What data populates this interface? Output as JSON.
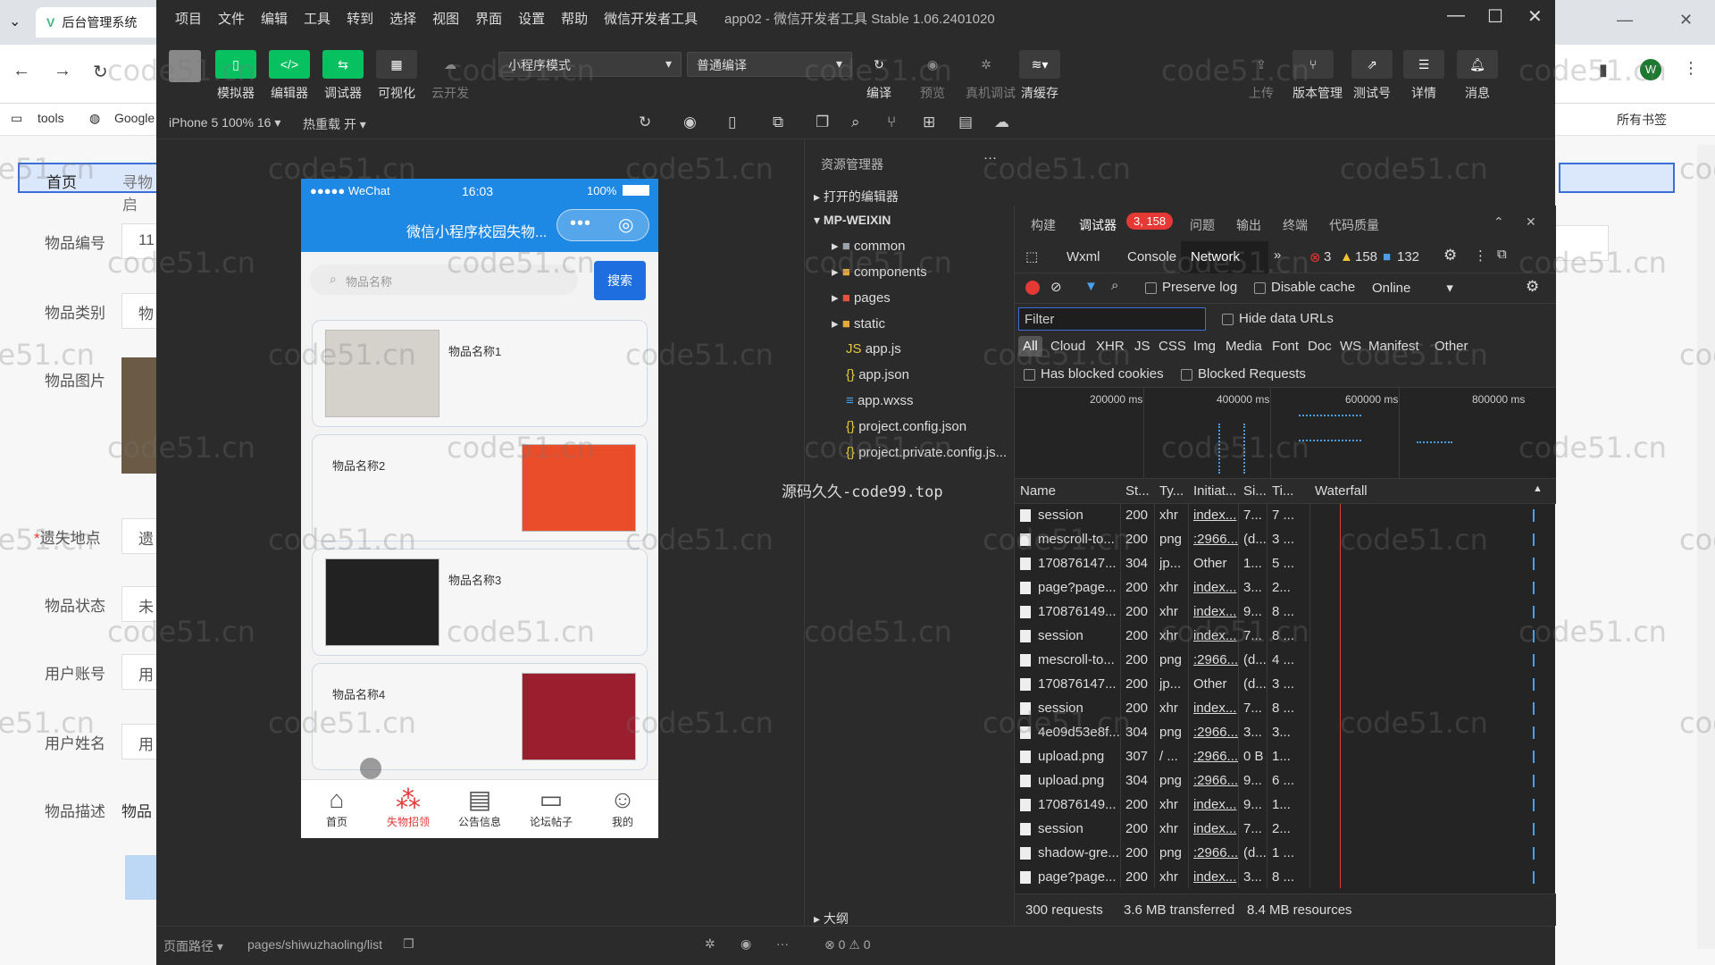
{
  "browser": {
    "tab_title": "后台管理系统",
    "bookmarks": [
      "tools",
      "Google"
    ],
    "all_bookmarks": "所有书签",
    "nav_items": [
      "首页",
      "寻物启"
    ],
    "form_labels": [
      "物品编号",
      "物品类别",
      "物品图片",
      "遗失地点",
      "物品状态",
      "用户账号",
      "用户姓名",
      "物品描述"
    ],
    "form_values": [
      "11",
      "物",
      "",
      "遗",
      "未",
      "用",
      "用",
      "物品"
    ]
  },
  "watermark": "code51.cn",
  "center_watermark": "源码久久-code99.top",
  "window": {
    "menu": [
      "项目",
      "文件",
      "编辑",
      "工具",
      "转到",
      "选择",
      "视图",
      "界面",
      "设置",
      "帮助",
      "微信开发者工具"
    ],
    "title": "app02 - 微信开发者工具 Stable 1.06.2401020"
  },
  "toolbar": {
    "simulator": "模拟器",
    "editor": "编辑器",
    "debugger": "调试器",
    "visual": "可视化",
    "cloud": "云开发",
    "mode_select": "小程序模式",
    "compile_select": "普通编译",
    "compile": "编译",
    "preview": "预览",
    "real_debug": "真机调试",
    "clear_cache": "清缓存",
    "upload": "上传",
    "version": "版本管理",
    "test": "测试号",
    "detail": "详情",
    "message": "消息"
  },
  "subbar": {
    "device": "iPhone 5 100% 16 ▾",
    "hot_reload": "热重载 开 ▾"
  },
  "phone": {
    "signal": "●●●●● WeChat",
    "time": "16:03",
    "battery": "100%",
    "title": "微信小程序校园失物...",
    "search_placeholder": "物品名称",
    "search_button": "搜索",
    "items": [
      "物品名称1",
      "物品名称2",
      "物品名称3",
      "物品名称4"
    ],
    "tabs": [
      "首页",
      "失物招领",
      "公告信息",
      "论坛帖子",
      "我的"
    ]
  },
  "explorer": {
    "header": "资源管理器",
    "open_editors": "打开的编辑器",
    "root": "MP-WEIXIN",
    "folders": [
      "common",
      "components",
      "pages",
      "static"
    ],
    "files": [
      "app.js",
      "app.json",
      "app.wxss",
      "project.config.json",
      "project.private.config.js..."
    ],
    "outline": "大纲"
  },
  "devtools": {
    "tabs": [
      "构建",
      "调试器",
      "问题",
      "输出",
      "终端",
      "代码质量"
    ],
    "badge": "3, 158",
    "panels": [
      "Wxml",
      "Console",
      "Network"
    ],
    "errors": "3",
    "warnings": "158",
    "infos": "132",
    "preserve_log": "Preserve log",
    "disable_cache": "Disable cache",
    "throttle": "Online",
    "filter_placeholder": "Filter",
    "hide_data_urls": "Hide data URLs",
    "types": [
      "All",
      "Cloud",
      "XHR",
      "JS",
      "CSS",
      "Img",
      "Media",
      "Font",
      "Doc",
      "WS",
      "Manifest",
      "Other"
    ],
    "has_blocked": "Has blocked cookies",
    "blocked_requests": "Blocked Requests",
    "timeline": [
      "200000 ms",
      "400000 ms",
      "600000 ms",
      "800000 ms"
    ],
    "columns": [
      "Name",
      "St...",
      "Ty...",
      "Initiat...",
      "Si...",
      "Ti...",
      "Waterfall"
    ],
    "rows": [
      [
        "session",
        "200",
        "xhr",
        "index...",
        "7...",
        "7 ..."
      ],
      [
        "mescroll-to...",
        "200",
        "png",
        ":2966...",
        "(d...",
        "3 ..."
      ],
      [
        "170876147...",
        "304",
        "jp...",
        "Other",
        "1...",
        "5 ..."
      ],
      [
        "page?page...",
        "200",
        "xhr",
        "index...",
        "3...",
        "2..."
      ],
      [
        "170876149...",
        "200",
        "xhr",
        "index...",
        "9...",
        "8 ..."
      ],
      [
        "session",
        "200",
        "xhr",
        "index...",
        "7...",
        "8 ..."
      ],
      [
        "mescroll-to...",
        "200",
        "png",
        ":2966...",
        "(d...",
        "4 ..."
      ],
      [
        "170876147...",
        "200",
        "jp...",
        "Other",
        "(d...",
        "3 ..."
      ],
      [
        "session",
        "200",
        "xhr",
        "index...",
        "7...",
        "8 ..."
      ],
      [
        "4e09d53e8f...",
        "304",
        "png",
        ":2966...",
        "3...",
        "3..."
      ],
      [
        "upload.png",
        "307",
        "/ ...",
        ":2966...",
        "0 B",
        "1..."
      ],
      [
        "upload.png",
        "304",
        "png",
        ":2966...",
        "9...",
        "6 ..."
      ],
      [
        "170876149...",
        "200",
        "xhr",
        "index...",
        "9...",
        "1..."
      ],
      [
        "session",
        "200",
        "xhr",
        "index...",
        "7...",
        "2..."
      ],
      [
        "shadow-gre...",
        "200",
        "png",
        ":2966...",
        "(d...",
        "1 ..."
      ],
      [
        "page?page...",
        "200",
        "xhr",
        "index...",
        "3...",
        "8 ..."
      ]
    ],
    "summary": [
      "300 requests",
      "3.6 MB transferred",
      "8.4 MB resources"
    ]
  },
  "status": {
    "route_label": "页面路径 ▾",
    "route": "pages/shiwuzhaoling/list",
    "errors": "⊗ 0 ⚠ 0"
  },
  "colors": {
    "accent_green": "#07c160",
    "wx_blue": "#1e88e5",
    "error_red": "#e53935"
  }
}
